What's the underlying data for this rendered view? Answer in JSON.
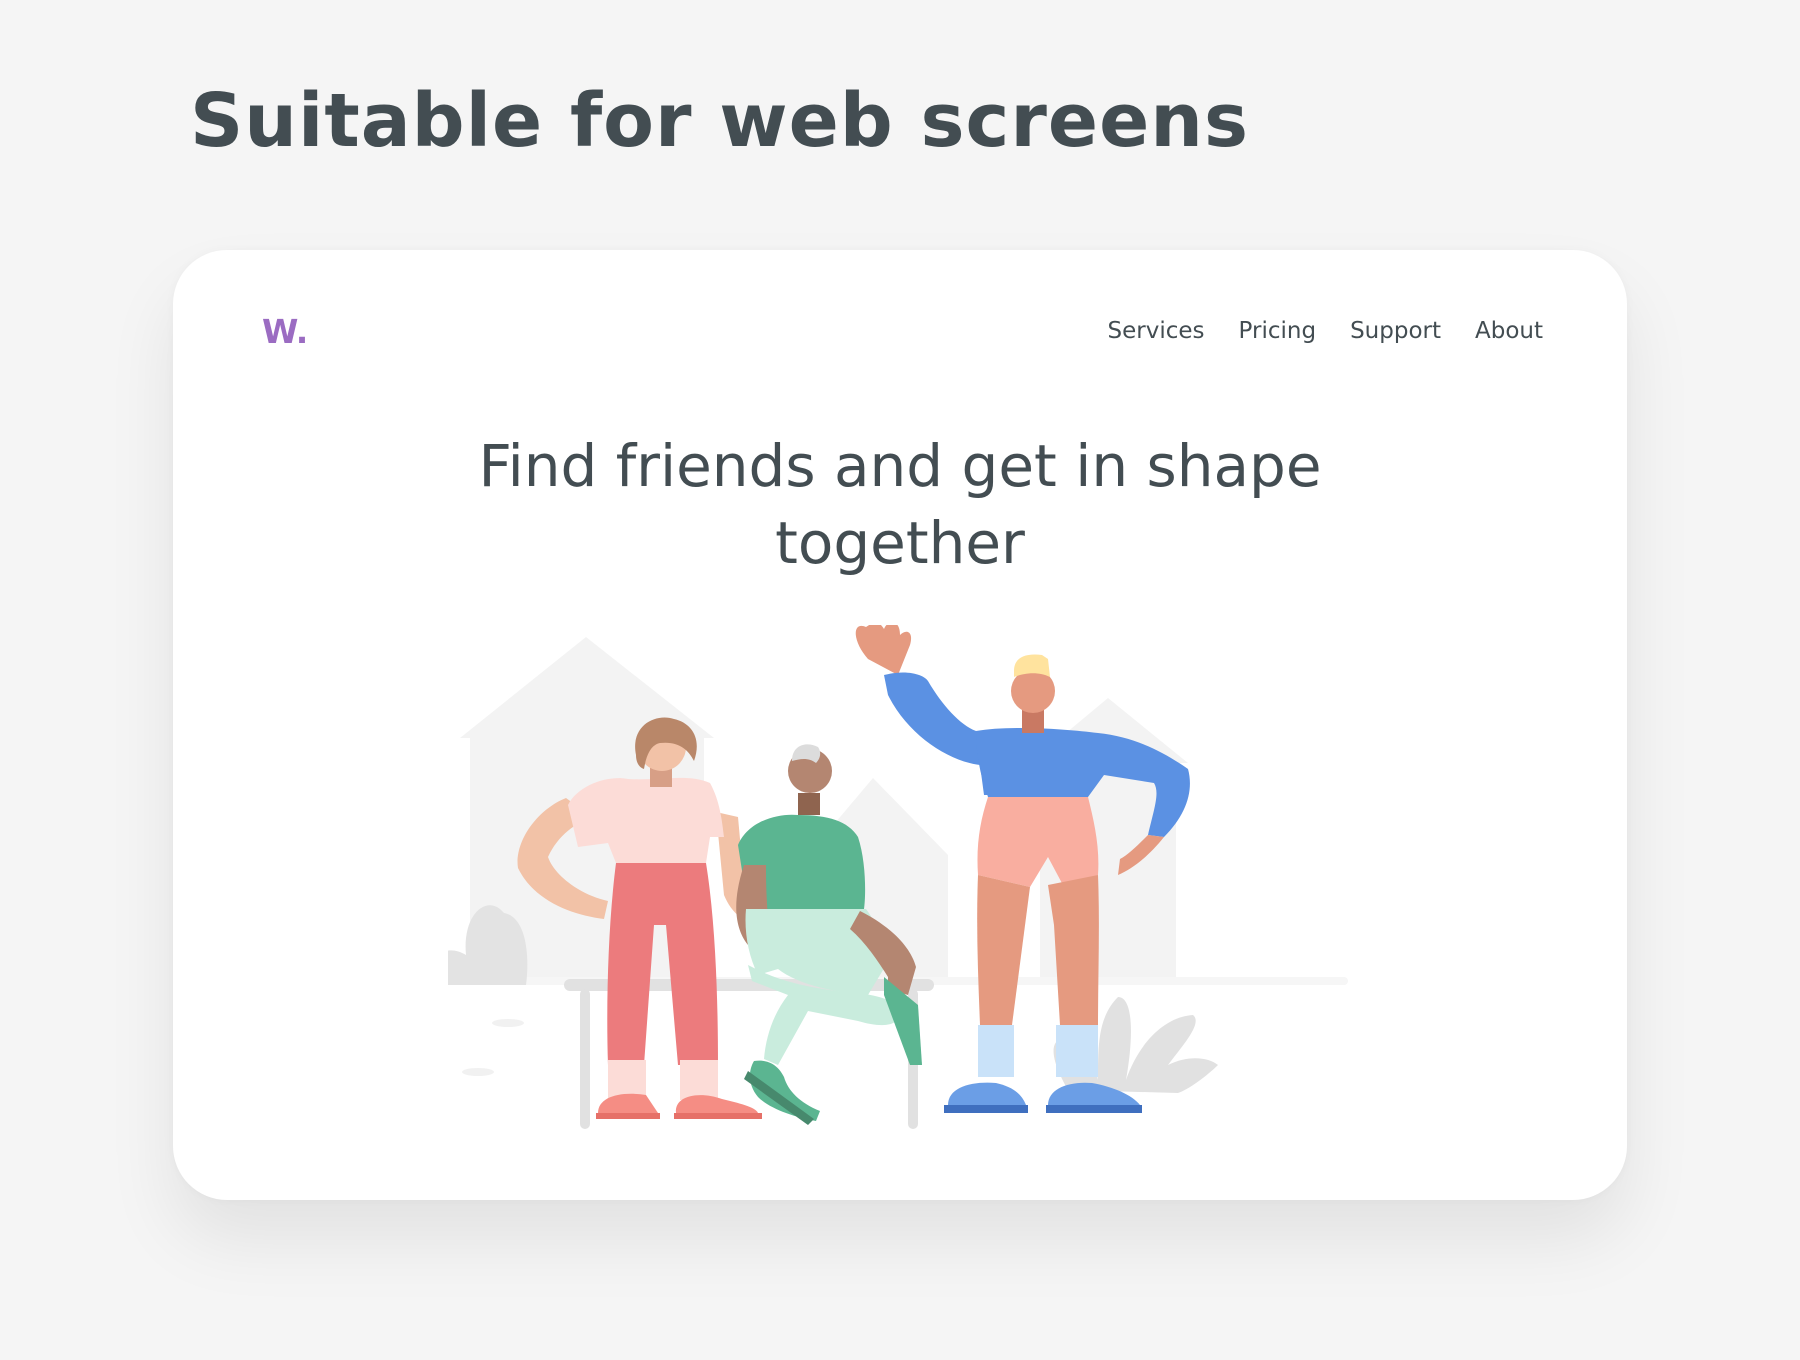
{
  "page": {
    "heading": "Suitable for web screens"
  },
  "site": {
    "logo": "W.",
    "nav": [
      {
        "label": "Services"
      },
      {
        "label": "Pricing"
      },
      {
        "label": "Support"
      },
      {
        "label": "About"
      }
    ],
    "hero": {
      "title_line1": "Find friends and get in shape",
      "title_line2": "together"
    }
  },
  "colors": {
    "background": "#f5f5f5",
    "card": "#ffffff",
    "text": "#434d52",
    "logo": "#9b6cc2"
  },
  "illustration": {
    "subject": "three-friends-illustration"
  }
}
